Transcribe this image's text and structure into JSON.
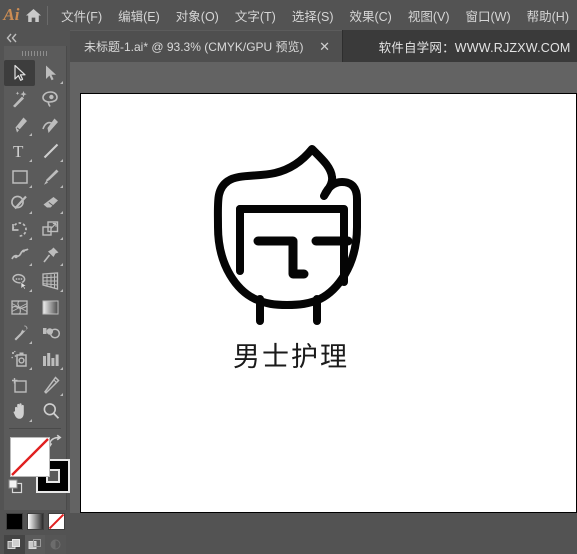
{
  "app": {
    "logo_text": "Ai",
    "home_icon": "home-icon"
  },
  "menubar": {
    "items": [
      {
        "label": "文件(F)",
        "name": "menu-file"
      },
      {
        "label": "编辑(E)",
        "name": "menu-edit"
      },
      {
        "label": "对象(O)",
        "name": "menu-object"
      },
      {
        "label": "文字(T)",
        "name": "menu-type"
      },
      {
        "label": "选择(S)",
        "name": "menu-select"
      },
      {
        "label": "效果(C)",
        "name": "menu-effect"
      },
      {
        "label": "视图(V)",
        "name": "menu-view"
      },
      {
        "label": "窗口(W)",
        "name": "menu-window"
      },
      {
        "label": "帮助(H)",
        "name": "menu-help"
      }
    ]
  },
  "tabbar": {
    "document_tab": {
      "title": "未标题-1.ai* @ 93.3% (CMYK/GPU 预览)",
      "close_label": "✕"
    },
    "watermark": "软件自学网：WWW.RJZXW.COM"
  },
  "toolpanel": {
    "collapse_label": "«",
    "tools": [
      {
        "name": "selection-tool",
        "tooltip": "选择工具",
        "active": true,
        "corner": false
      },
      {
        "name": "direct-selection-tool",
        "tooltip": "直接选择工具",
        "active": false,
        "corner": true
      },
      {
        "name": "magic-wand-tool",
        "tooltip": "魔棒工具",
        "active": false,
        "corner": false
      },
      {
        "name": "lasso-tool",
        "tooltip": "套索工具",
        "active": false,
        "corner": false
      },
      {
        "name": "pen-tool",
        "tooltip": "钢笔工具",
        "active": false,
        "corner": true
      },
      {
        "name": "curvature-tool",
        "tooltip": "曲率工具",
        "active": false,
        "corner": false
      },
      {
        "name": "type-tool",
        "tooltip": "文字工具",
        "active": false,
        "corner": true
      },
      {
        "name": "line-segment-tool",
        "tooltip": "直线段工具",
        "active": false,
        "corner": true
      },
      {
        "name": "rectangle-tool",
        "tooltip": "矩形工具",
        "active": false,
        "corner": true
      },
      {
        "name": "paintbrush-tool",
        "tooltip": "画笔工具",
        "active": false,
        "corner": true
      },
      {
        "name": "shaper-tool",
        "tooltip": "Shaper 工具",
        "active": false,
        "corner": true
      },
      {
        "name": "eraser-tool",
        "tooltip": "橡皮擦工具",
        "active": false,
        "corner": true
      },
      {
        "name": "rotate-tool",
        "tooltip": "旋转工具",
        "active": false,
        "corner": true
      },
      {
        "name": "scale-tool",
        "tooltip": "比例缩放工具",
        "active": false,
        "corner": true
      },
      {
        "name": "width-tool",
        "tooltip": "宽度工具",
        "active": false,
        "corner": true
      },
      {
        "name": "free-transform-tool",
        "tooltip": "自由变换工具",
        "active": false,
        "corner": true
      },
      {
        "name": "shape-builder-tool",
        "tooltip": "形状生成器工具",
        "active": false,
        "corner": true
      },
      {
        "name": "perspective-grid-tool",
        "tooltip": "透视网格工具",
        "active": false,
        "corner": true
      },
      {
        "name": "mesh-tool",
        "tooltip": "网格工具",
        "active": false,
        "corner": false
      },
      {
        "name": "gradient-tool",
        "tooltip": "渐变工具",
        "active": false,
        "corner": false
      },
      {
        "name": "eyedropper-tool",
        "tooltip": "吸管工具",
        "active": false,
        "corner": true
      },
      {
        "name": "blend-tool",
        "tooltip": "混合工具",
        "active": false,
        "corner": false
      },
      {
        "name": "symbol-sprayer-tool",
        "tooltip": "符号喷枪工具",
        "active": false,
        "corner": true
      },
      {
        "name": "column-graph-tool",
        "tooltip": "柱形图工具",
        "active": false,
        "corner": true
      },
      {
        "name": "artboard-tool",
        "tooltip": "画板工具",
        "active": false,
        "corner": false
      },
      {
        "name": "slice-tool",
        "tooltip": "切片工具",
        "active": false,
        "corner": true
      },
      {
        "name": "hand-tool",
        "tooltip": "抓手工具",
        "active": false,
        "corner": true
      },
      {
        "name": "zoom-tool",
        "tooltip": "缩放工具",
        "active": false,
        "corner": false
      }
    ],
    "fill_stroke": {
      "fill_label": "填色",
      "fill_value": "无",
      "stroke_label": "描边",
      "stroke_value": "黑色",
      "swap_label": "互换填色和描边",
      "default_label": "默认填色和描边"
    },
    "color_modes": [
      {
        "name": "color-mode-color",
        "label": "颜色"
      },
      {
        "name": "color-mode-gradient",
        "label": "渐变"
      },
      {
        "name": "color-mode-none",
        "label": "无"
      }
    ],
    "draw_modes": [
      {
        "name": "draw-normal-mode",
        "label": "正常绘图",
        "active": true,
        "disabled": false
      },
      {
        "name": "draw-behind-mode",
        "label": "背面绘图",
        "active": false,
        "disabled": false
      },
      {
        "name": "draw-inside-mode",
        "label": "内部绘图",
        "active": false,
        "disabled": true
      }
    ]
  },
  "canvas": {
    "artwork": {
      "name": "mens-care-logo",
      "caption": "男士护理",
      "stroke_color": "#000000",
      "fill_color": "#ffffff"
    }
  },
  "colors": {
    "chrome": "#535353",
    "tabbar": "#3a3a3a",
    "tab_active": "#4f4f4f",
    "canvas_bg": "#636363",
    "artboard": "#ffffff",
    "accent": "#cc8d54",
    "text": "#d6d6d6",
    "icon": "#b9b9b9"
  }
}
